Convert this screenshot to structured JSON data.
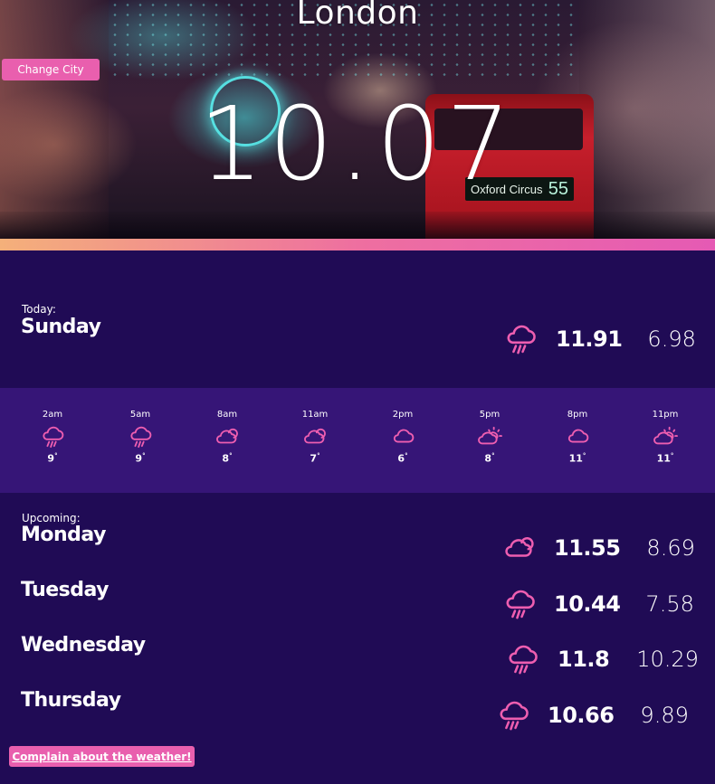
{
  "header": {
    "city": "London",
    "time": "10.07",
    "change_city_label": "Change City"
  },
  "today": {
    "label": "Today:",
    "day": "Sunday",
    "icon": "rain-cloud-icon",
    "high": "11.91",
    "low": "6.98"
  },
  "hourly": [
    {
      "time": "2am",
      "icon": "rain-cloud-icon",
      "temp": "9"
    },
    {
      "time": "5am",
      "icon": "rain-cloud-icon",
      "temp": "9"
    },
    {
      "time": "8am",
      "icon": "partly-cloudy-night-icon",
      "temp": "8"
    },
    {
      "time": "11am",
      "icon": "partly-cloudy-night-icon",
      "temp": "7"
    },
    {
      "time": "2pm",
      "icon": "cloud-icon",
      "temp": "6"
    },
    {
      "time": "5pm",
      "icon": "partly-sunny-icon",
      "temp": "8"
    },
    {
      "time": "8pm",
      "icon": "cloud-icon",
      "temp": "11"
    },
    {
      "time": "11pm",
      "icon": "partly-sunny-icon",
      "temp": "11"
    }
  ],
  "upcoming": {
    "label": "Upcoming:",
    "days": [
      {
        "day": "Monday",
        "icon": "partly-cloudy-night-icon",
        "high": "11.55",
        "low": "8.69"
      },
      {
        "day": "Tuesday",
        "icon": "rain-cloud-icon",
        "high": "10.44",
        "low": "7.58"
      },
      {
        "day": "Wednesday",
        "icon": "rain-cloud-icon",
        "high": "11.8",
        "low": "10.29"
      },
      {
        "day": "Thursday",
        "icon": "rain-cloud-icon",
        "high": "10.66",
        "low": "9.89"
      }
    ]
  },
  "footer": {
    "complain_label": "Complain about the weather!"
  },
  "colors": {
    "accent": "#e95fae",
    "background": "#200b55",
    "hourly_background": "#361577",
    "icon": "#ee5eb0"
  }
}
